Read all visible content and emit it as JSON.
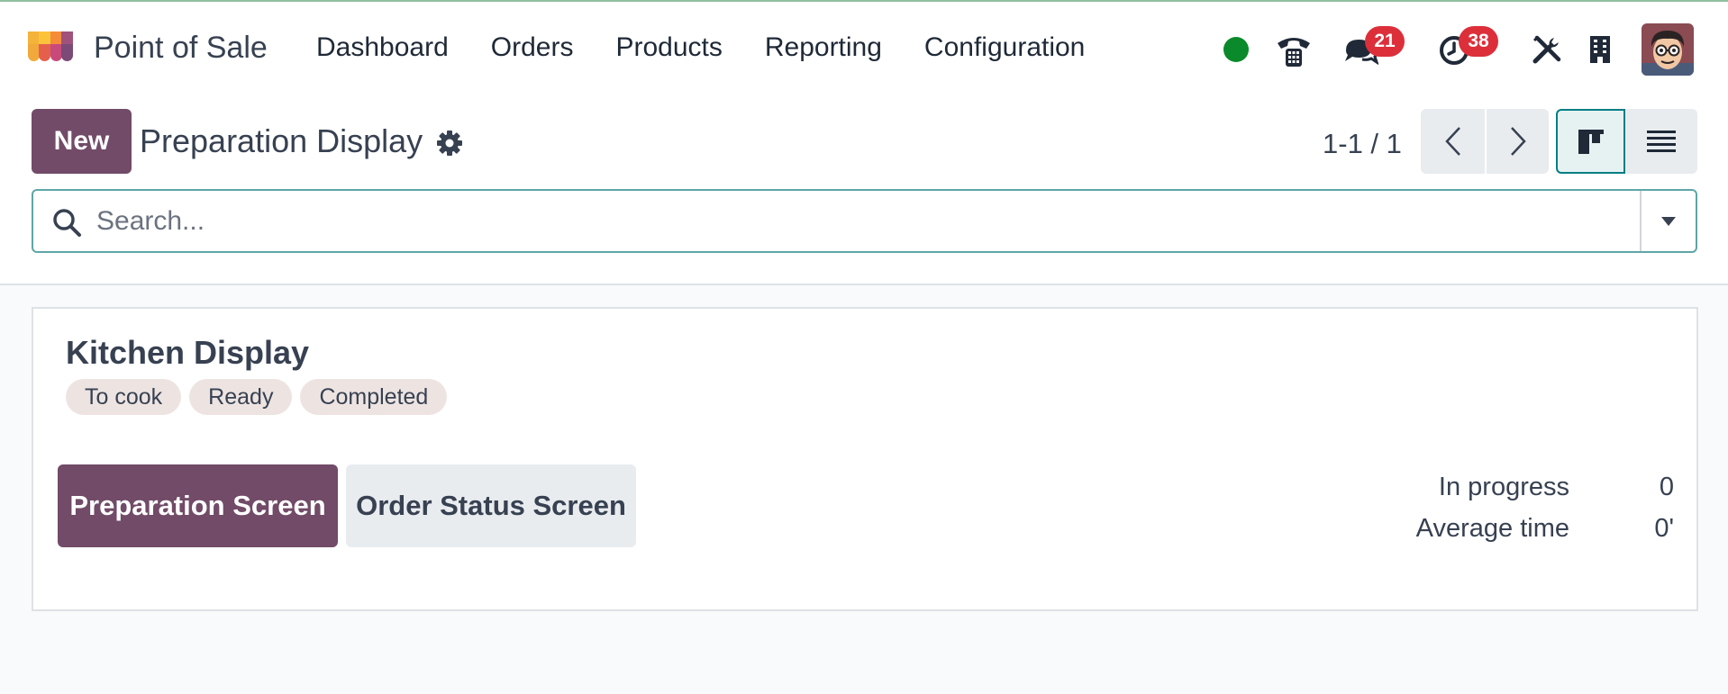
{
  "navbar": {
    "app_name": "Point of Sale",
    "menu": [
      "Dashboard",
      "Orders",
      "Products",
      "Reporting",
      "Configuration"
    ],
    "messages_count": "21",
    "activities_count": "38",
    "status_color": "#0a8a2a"
  },
  "control_panel": {
    "new_label": "New",
    "title": "Preparation Display",
    "pager": "1-1 / 1",
    "search_placeholder": "Search..."
  },
  "card": {
    "title": "Kitchen Display",
    "tags": [
      "To cook",
      "Ready",
      "Completed"
    ],
    "buttons": {
      "preparation": "Preparation Screen",
      "order_status": "Order Status Screen"
    },
    "stats": [
      {
        "label": "In progress",
        "value": "0"
      },
      {
        "label": "Average time",
        "value": "0'"
      }
    ]
  },
  "colors": {
    "brand": "#714b67",
    "accent": "#017e84",
    "badge": "#dc2f3a"
  }
}
